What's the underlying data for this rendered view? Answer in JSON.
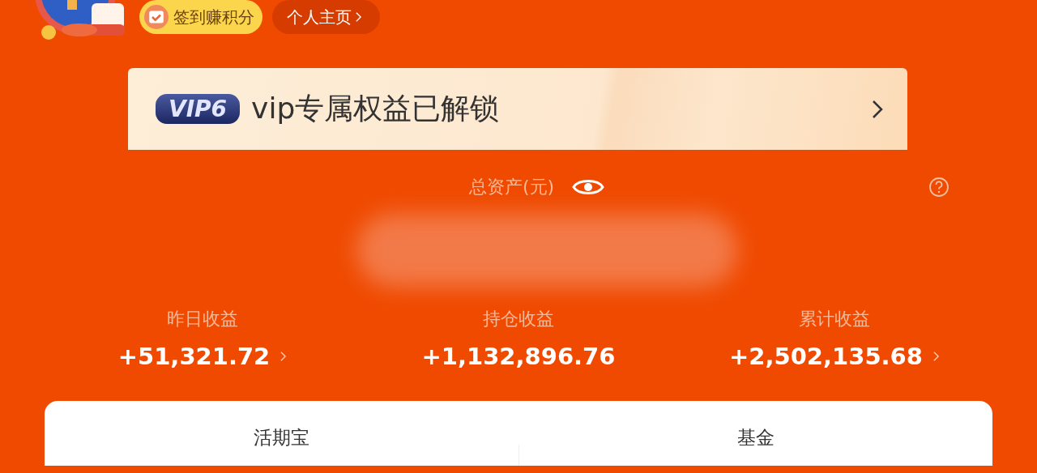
{
  "header": {
    "checkin_button": "签到赚积分",
    "profile_link": "个人主页"
  },
  "vip_banner": {
    "level_badge": "VIP6",
    "text": "vip专属权益已解锁"
  },
  "total_assets": {
    "label": "总资产(元)",
    "hidden": false
  },
  "stats": [
    {
      "label": "昨日收益",
      "value": "+51,321.72",
      "has_arrow": true
    },
    {
      "label": "持仓收益",
      "value": "+1,132,896.76",
      "has_arrow": false
    },
    {
      "label": "累计收益",
      "value": "+2,502,135.68",
      "has_arrow": true
    }
  ],
  "accounts": [
    {
      "label": "活期宝"
    },
    {
      "label": "基金"
    }
  ]
}
